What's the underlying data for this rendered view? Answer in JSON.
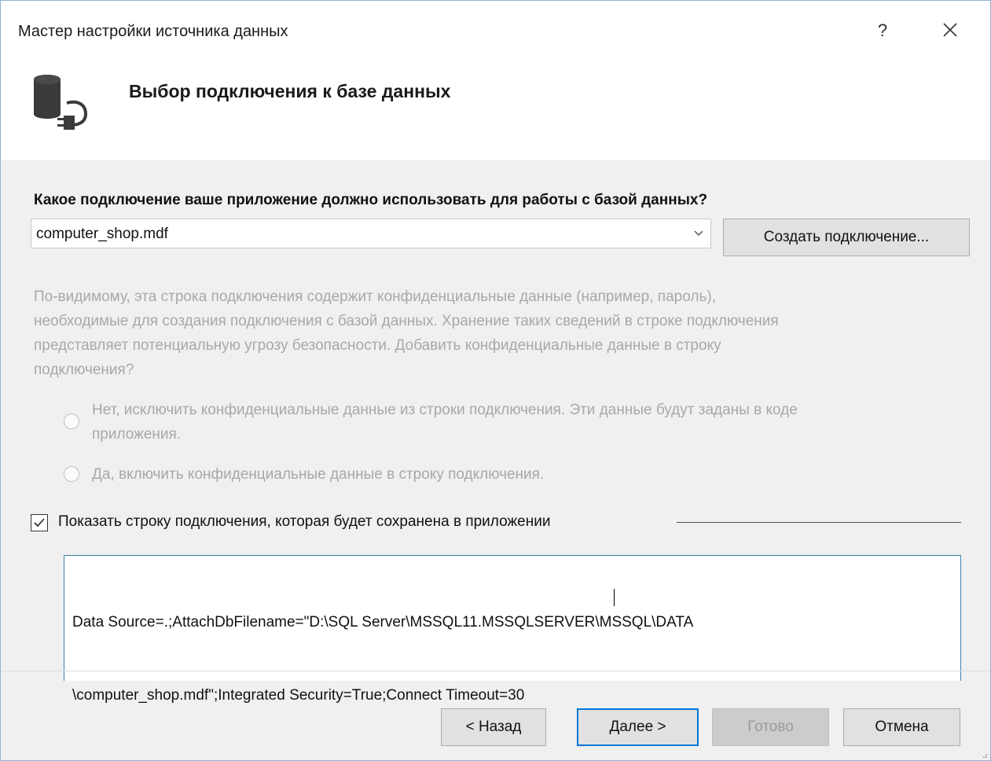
{
  "window": {
    "title": "Мастер настройки источника данных",
    "help_label": "?"
  },
  "header": {
    "title": "Выбор подключения к базе данных",
    "icon": "database-connection-icon"
  },
  "connection": {
    "question": "Какое подключение ваше приложение должно использовать для работы с базой данных?",
    "selected": "computer_shop.mdf",
    "create_button": "Создать подключение..."
  },
  "sensitive": {
    "warning_lines": [
      "По-видимому, эта строка подключения содержит конфиденциальные данные (например, пароль),",
      "необходимые для создания подключения с базой данных. Хранение таких сведений в строке подключения",
      "представляет потенциальную угрозу безопасности. Добавить конфиденциальные данные в строку",
      "подключения?"
    ],
    "option_no_lines": [
      "Нет, исключить конфиденциальные данные из строки подключения. Эти данные будут заданы в коде",
      "приложения."
    ],
    "option_yes": "Да, включить конфиденциальные данные в строку подключения.",
    "enabled": false
  },
  "show_string": {
    "label": "Показать строку подключения, которая будет сохранена в приложении",
    "checked": true,
    "lines": [
      "Data Source=.;AttachDbFilename=\"D:\\SQL Server\\MSSQL11.MSSQLSERVER\\MSSQL\\DATA",
      "\\computer_shop.mdf\";Integrated Security=True;Connect Timeout=30"
    ]
  },
  "footer": {
    "back": "< Назад",
    "next": "Далее >",
    "finish": "Готово",
    "cancel": "Отмена"
  },
  "colors": {
    "focus_border": "#0078d7",
    "disabled_text": "#a8a8a8"
  }
}
